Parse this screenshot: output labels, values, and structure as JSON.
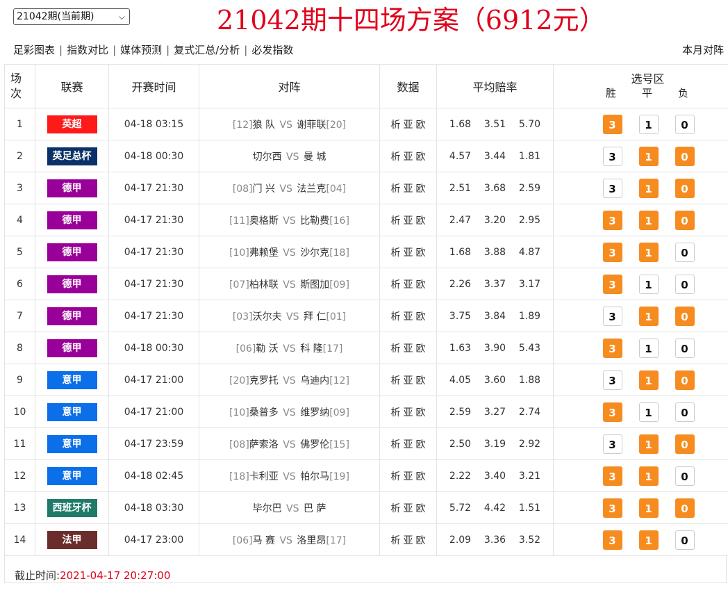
{
  "period": {
    "value": "21042期(当前期)"
  },
  "title": "21042期十四场方案（6912元）",
  "nav": [
    "足彩图表",
    "指数对比",
    "媒体预测",
    "复式汇总/分析",
    "必发指数"
  ],
  "month_link": "本月对阵",
  "headers": {
    "num": "场次",
    "league": "联赛",
    "time": "开赛时间",
    "match": "对阵",
    "data": "数据",
    "odds": "平均赔率",
    "picks": "选号区",
    "win": "胜",
    "draw": "平",
    "lose": "负"
  },
  "data_labels": [
    "析",
    "亚",
    "欧"
  ],
  "rows": [
    {
      "n": "1",
      "league": "英超",
      "color": "#ff1a1a",
      "time": "04-18 03:15",
      "hr": "[12]",
      "home": "狼 队",
      "away": "谢菲联",
      "ar": "[20]",
      "o1": "1.68",
      "o2": "3.51",
      "o3": "5.70",
      "w": "3",
      "d": "1",
      "l": "0",
      "ws": true,
      "ds": false,
      "ls": false
    },
    {
      "n": "2",
      "league": "英足总杯",
      "color": "#0a3268",
      "time": "04-18 00:30",
      "hr": "",
      "home": "切尔西",
      "away": "曼 城",
      "ar": "",
      "o1": "4.57",
      "o2": "3.44",
      "o3": "1.81",
      "w": "3",
      "d": "1",
      "l": "0",
      "ws": false,
      "ds": true,
      "ls": true
    },
    {
      "n": "3",
      "league": "德甲",
      "color": "#990099",
      "time": "04-17 21:30",
      "hr": "[08]",
      "home": "门 兴",
      "away": "法兰克",
      "ar": "[04]",
      "o1": "2.51",
      "o2": "3.68",
      "o3": "2.59",
      "w": "3",
      "d": "1",
      "l": "0",
      "ws": false,
      "ds": true,
      "ls": true
    },
    {
      "n": "4",
      "league": "德甲",
      "color": "#990099",
      "time": "04-17 21:30",
      "hr": "[11]",
      "home": "奥格斯",
      "away": "比勒费",
      "ar": "[16]",
      "o1": "2.47",
      "o2": "3.20",
      "o3": "2.95",
      "w": "3",
      "d": "1",
      "l": "0",
      "ws": true,
      "ds": true,
      "ls": true
    },
    {
      "n": "5",
      "league": "德甲",
      "color": "#990099",
      "time": "04-17 21:30",
      "hr": "[10]",
      "home": "弗赖堡",
      "away": "沙尔克",
      "ar": "[18]",
      "o1": "1.68",
      "o2": "3.88",
      "o3": "4.87",
      "w": "3",
      "d": "1",
      "l": "0",
      "ws": true,
      "ds": true,
      "ls": false
    },
    {
      "n": "6",
      "league": "德甲",
      "color": "#990099",
      "time": "04-17 21:30",
      "hr": "[07]",
      "home": "柏林联",
      "away": "斯图加",
      "ar": "[09]",
      "o1": "2.26",
      "o2": "3.37",
      "o3": "3.17",
      "w": "3",
      "d": "1",
      "l": "0",
      "ws": true,
      "ds": false,
      "ls": false
    },
    {
      "n": "7",
      "league": "德甲",
      "color": "#990099",
      "time": "04-17 21:30",
      "hr": "[03]",
      "home": "沃尔夫",
      "away": "拜 仁",
      "ar": "[01]",
      "o1": "3.75",
      "o2": "3.84",
      "o3": "1.89",
      "w": "3",
      "d": "1",
      "l": "0",
      "ws": false,
      "ds": true,
      "ls": true
    },
    {
      "n": "8",
      "league": "德甲",
      "color": "#990099",
      "time": "04-18 00:30",
      "hr": "[06]",
      "home": "勒 沃",
      "away": "科 隆",
      "ar": "[17]",
      "o1": "1.63",
      "o2": "3.90",
      "o3": "5.43",
      "w": "3",
      "d": "1",
      "l": "0",
      "ws": true,
      "ds": false,
      "ls": false
    },
    {
      "n": "9",
      "league": "意甲",
      "color": "#0a6fe8",
      "time": "04-17 21:00",
      "hr": "[20]",
      "home": "克罗托",
      "away": "乌迪内",
      "ar": "[12]",
      "o1": "4.05",
      "o2": "3.60",
      "o3": "1.88",
      "w": "3",
      "d": "1",
      "l": "0",
      "ws": false,
      "ds": true,
      "ls": true
    },
    {
      "n": "10",
      "league": "意甲",
      "color": "#0a6fe8",
      "time": "04-17 21:00",
      "hr": "[10]",
      "home": "桑普多",
      "away": "维罗纳",
      "ar": "[09]",
      "o1": "2.59",
      "o2": "3.27",
      "o3": "2.74",
      "w": "3",
      "d": "1",
      "l": "0",
      "ws": true,
      "ds": false,
      "ls": false
    },
    {
      "n": "11",
      "league": "意甲",
      "color": "#0a6fe8",
      "time": "04-17 23:59",
      "hr": "[08]",
      "home": "萨索洛",
      "away": "佛罗伦",
      "ar": "[15]",
      "o1": "2.50",
      "o2": "3.19",
      "o3": "2.92",
      "w": "3",
      "d": "1",
      "l": "0",
      "ws": false,
      "ds": true,
      "ls": true
    },
    {
      "n": "12",
      "league": "意甲",
      "color": "#0a6fe8",
      "time": "04-18 02:45",
      "hr": "[18]",
      "home": "卡利亚",
      "away": "帕尔马",
      "ar": "[19]",
      "o1": "2.22",
      "o2": "3.40",
      "o3": "3.21",
      "w": "3",
      "d": "1",
      "l": "0",
      "ws": true,
      "ds": true,
      "ls": false
    },
    {
      "n": "13",
      "league": "西班牙杯",
      "color": "#1f7a6a",
      "time": "04-18 03:30",
      "hr": "",
      "home": "毕尔巴",
      "away": "巴 萨",
      "ar": "",
      "o1": "5.72",
      "o2": "4.42",
      "o3": "1.51",
      "w": "3",
      "d": "1",
      "l": "0",
      "ws": true,
      "ds": true,
      "ls": true
    },
    {
      "n": "14",
      "league": "法甲",
      "color": "#6b2c2c",
      "time": "04-17 23:00",
      "hr": "[06]",
      "home": "马 赛",
      "away": "洛里昂",
      "ar": "[17]",
      "o1": "2.09",
      "o2": "3.36",
      "o3": "3.52",
      "w": "3",
      "d": "1",
      "l": "0",
      "ws": true,
      "ds": true,
      "ls": false
    }
  ],
  "vs": "VS",
  "footer": {
    "label": "截止时间:",
    "time": "2021-04-17 20:27:00"
  }
}
